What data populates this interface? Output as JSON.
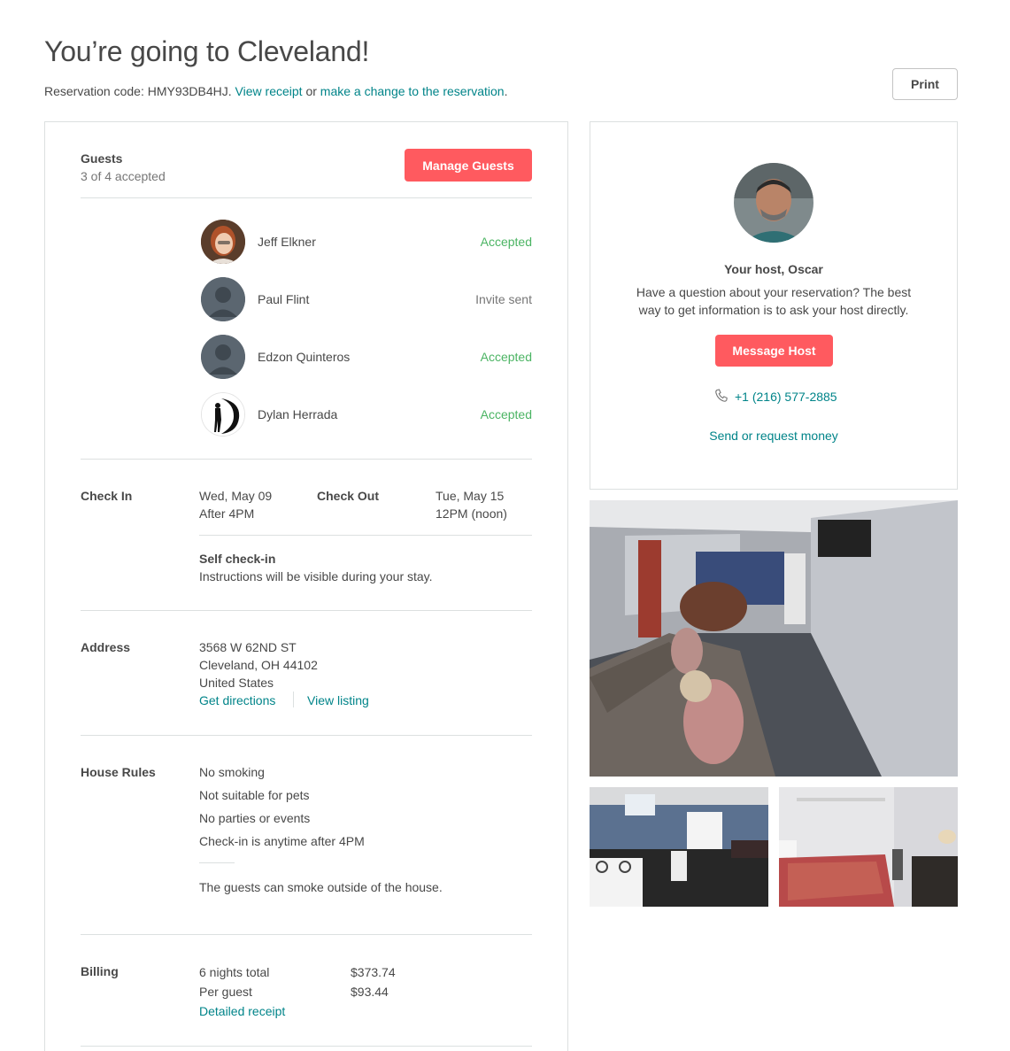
{
  "header": {
    "title": "You’re going to Cleveland!",
    "reservation_prefix": "Reservation code: HMY93DB4HJ.",
    "view_receipt": "View receipt",
    "or": "or",
    "make_change": "make a change to the reservation",
    "period": ".",
    "print_label": "Print"
  },
  "guests": {
    "title": "Guests",
    "summary": "3 of 4 accepted",
    "manage_label": "Manage Guests",
    "list": [
      {
        "name": "Jeff Elkner",
        "status": "Accepted"
      },
      {
        "name": "Paul Flint",
        "status": "Invite sent"
      },
      {
        "name": "Edzon Quinteros",
        "status": "Accepted"
      },
      {
        "name": "Dylan Herrada",
        "status": "Accepted"
      }
    ]
  },
  "checkin": {
    "label": "Check In",
    "date": "Wed, May 09",
    "time": "After 4PM",
    "checkout_label": "Check Out",
    "checkout_date": "Tue, May 15",
    "checkout_time": "12PM (noon)",
    "self_title": "Self check-in",
    "self_desc": "Instructions will be visible during your stay."
  },
  "address": {
    "label": "Address",
    "line1": "3568 W 62ND ST",
    "line2": "Cleveland, OH 44102",
    "line3": "United States",
    "directions": "Get directions",
    "view_listing": "View listing"
  },
  "rules": {
    "label": "House Rules",
    "items": [
      "No smoking",
      "Not suitable for pets",
      "No parties or events",
      "Check-in is anytime after 4PM"
    ],
    "note": "The guests can smoke outside of the house."
  },
  "billing": {
    "label": "Billing",
    "nights_label": "6 nights total",
    "nights_value": "$373.74",
    "per_guest_label": "Per guest",
    "per_guest_value": "$93.44",
    "receipt_link": "Detailed receipt"
  },
  "host": {
    "title": "Your host, Oscar",
    "desc1": "Have a question about your reservation? The best",
    "desc2": "way to get information is to ask your host directly.",
    "message_label": "Message Host",
    "phone": "+1 (216) 577-2885",
    "money_link": "Send or request money"
  },
  "colors": {
    "accent": "#008489",
    "brand": "#ff5a5f",
    "accepted": "#4bb463",
    "text": "#484848",
    "muted": "#767676"
  }
}
